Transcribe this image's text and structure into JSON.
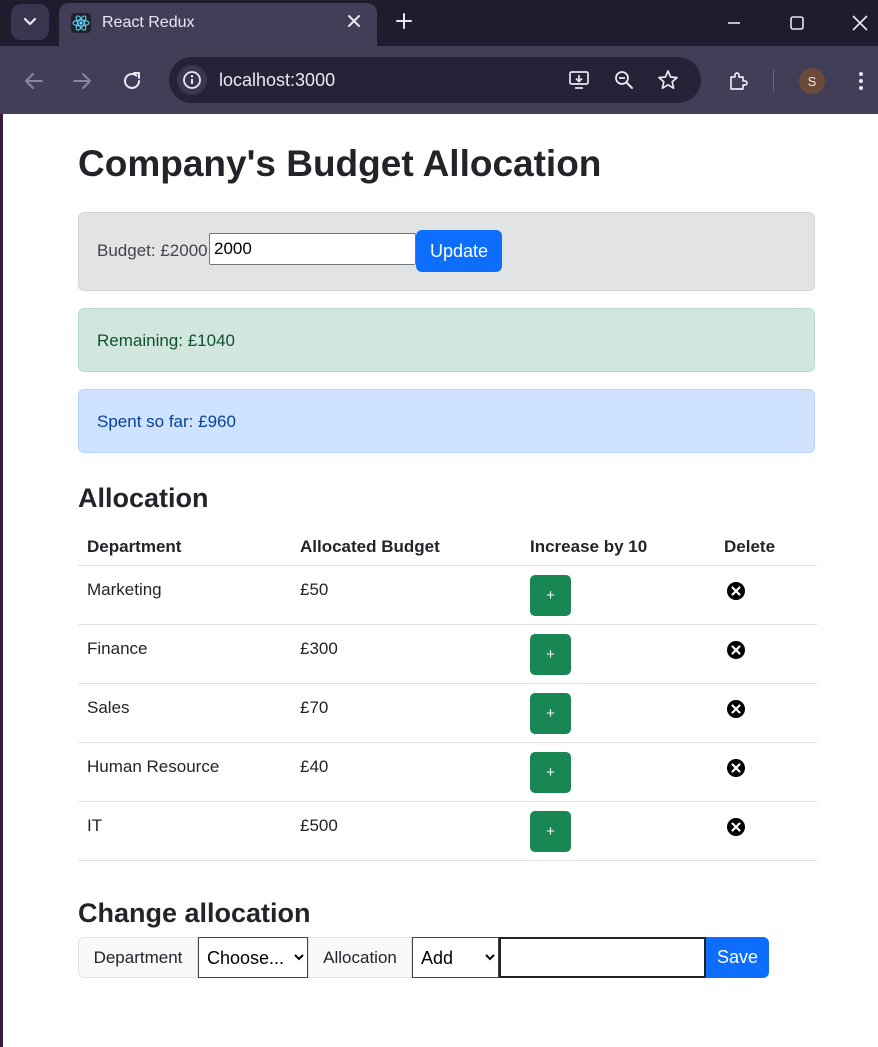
{
  "browser": {
    "tab_title": "React Redux",
    "url": "localhost:3000",
    "profile_initial": "S"
  },
  "page": {
    "title": "Company's Budget Allocation",
    "budget": {
      "label": "Budget: £2000",
      "input_value": "2000",
      "update_label": "Update"
    },
    "remaining": "Remaining: £1040",
    "spent": "Spent so far: £960",
    "allocation_heading": "Allocation",
    "table": {
      "headers": [
        "Department",
        "Allocated Budget",
        "Increase by 10",
        "Delete"
      ],
      "rows": [
        {
          "department": "Marketing",
          "budget": "£50"
        },
        {
          "department": "Finance",
          "budget": "£300"
        },
        {
          "department": "Sales",
          "budget": "£70"
        },
        {
          "department": "Human Resource",
          "budget": "£40"
        },
        {
          "department": "IT",
          "budget": "£500"
        }
      ],
      "increase_label": "+"
    },
    "change_heading": "Change allocation",
    "change": {
      "department_label": "Department",
      "department_select": "Choose...",
      "allocation_label": "Allocation",
      "allocation_select": "Add",
      "amount_value": "",
      "save_label": "Save"
    }
  },
  "colors": {
    "primary": "#0d6efd",
    "success": "#198754",
    "chrome_dark": "#1f1c2e",
    "chrome_tab": "#433e58"
  }
}
